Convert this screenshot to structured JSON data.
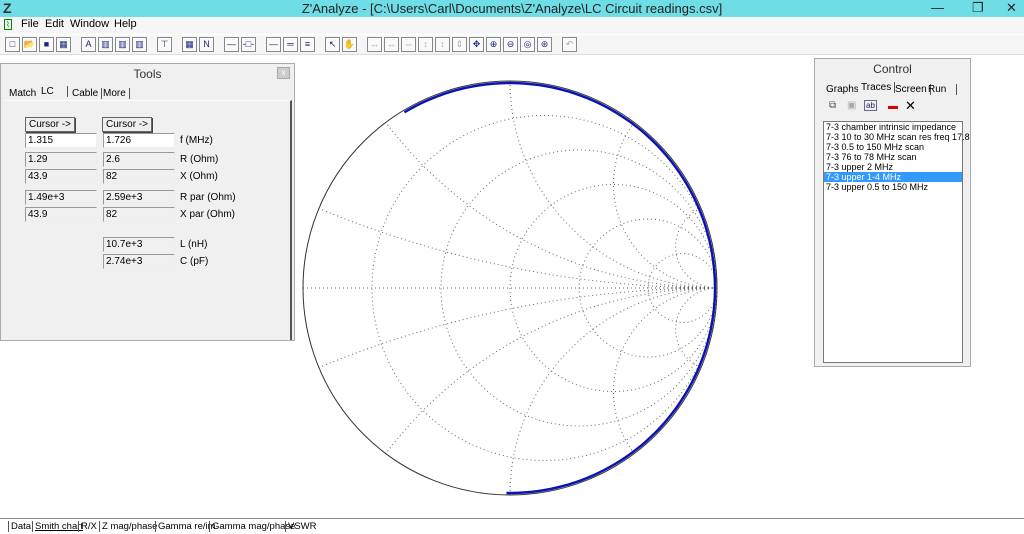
{
  "window": {
    "logo": "Z",
    "title": "Z'Analyze - [C:\\Users\\Carl\\Documents\\Z'Analyze\\LC Circuit readings.csv]"
  },
  "menu": [
    "File",
    "Edit",
    "Window",
    "Help"
  ],
  "tools": {
    "title": "Tools",
    "tabs": [
      "Match",
      "LC",
      "Cable",
      "More"
    ],
    "active_tab": "LC",
    "cursor_labels": [
      "Cursor ->",
      "Cursor ->"
    ],
    "rows": [
      {
        "label": "f (MHz)",
        "a": "1.315",
        "b": "1.726"
      },
      {
        "label": "R (Ohm)",
        "a": "1.29",
        "b": "2.6"
      },
      {
        "label": "X (Ohm)",
        "a": "43.9",
        "b": "82"
      },
      {
        "label": "R par (Ohm)",
        "a": "1.49e+3",
        "b": "2.59e+3"
      },
      {
        "label": "X par (Ohm)",
        "a": "43.9",
        "b": "82"
      }
    ],
    "L": {
      "label": "L (nH)",
      "value": "10.7e+3"
    },
    "C": {
      "label": "C (pF)",
      "value": "2.74e+3"
    }
  },
  "control": {
    "title": "Control",
    "tabs": [
      "Graphs",
      "Traces",
      "Screen",
      "Run"
    ],
    "active_tab": "Traces",
    "traces": [
      "7-3 chamber intrinsic impedance",
      "7-3 10 to 30 MHz scan res freq 17.8",
      "7-3 0.5 to 150 MHz scan",
      "7-3  76 to 78 MHz scan",
      "7-3 upper 2 MHz",
      "7-3 upper 1-4 MHz",
      "7-3 upper 0.5 to 150 MHz"
    ],
    "selected_index": 5
  },
  "bottom_tabs": [
    "Data",
    "Smith chart",
    "R/X",
    "Z mag/phase",
    "Gamma re/im",
    "Gamma mag/phase",
    "VSWR"
  ],
  "active_bottom_tab": "Smith chart",
  "colors": {
    "trace": "#0a14b4",
    "titlebar": "#6fdde6",
    "selection": "#3399ff"
  }
}
